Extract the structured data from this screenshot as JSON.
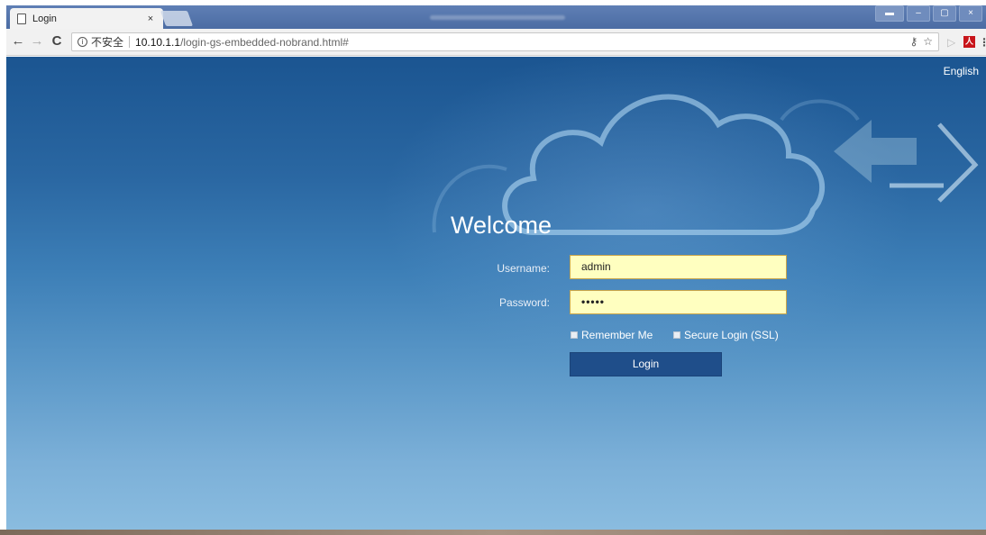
{
  "browser": {
    "tab_title": "Login",
    "tab_close": "×",
    "not_secure": "不安全",
    "url_host": "10.10.1.1",
    "url_path": "/login-gs-embedded-nobrand.html#",
    "info_glyph": "i",
    "back_glyph": "←",
    "forward_glyph": "→",
    "reload_glyph": "C",
    "key_glyph": "⚷",
    "star_glyph": "☆",
    "play_glyph": "▷",
    "pdf_glyph": "人",
    "menu_glyph": "⋮",
    "minimize_glyph": "–",
    "maximize_glyph": "▢",
    "close_glyph": "×",
    "user_glyph": "▬"
  },
  "page": {
    "language": "English",
    "welcome": "Welcome",
    "username_label": "Username:",
    "username_value": "admin",
    "password_label": "Password:",
    "password_value": "•••••",
    "remember_label": "Remember Me",
    "ssl_label": "Secure Login (SSL)",
    "login_button": "Login"
  },
  "colors": {
    "field_bg": "#ffffc0",
    "button_bg": "#1f4e8a",
    "page_top": "#1b5591",
    "page_bottom": "#8bbde0"
  }
}
